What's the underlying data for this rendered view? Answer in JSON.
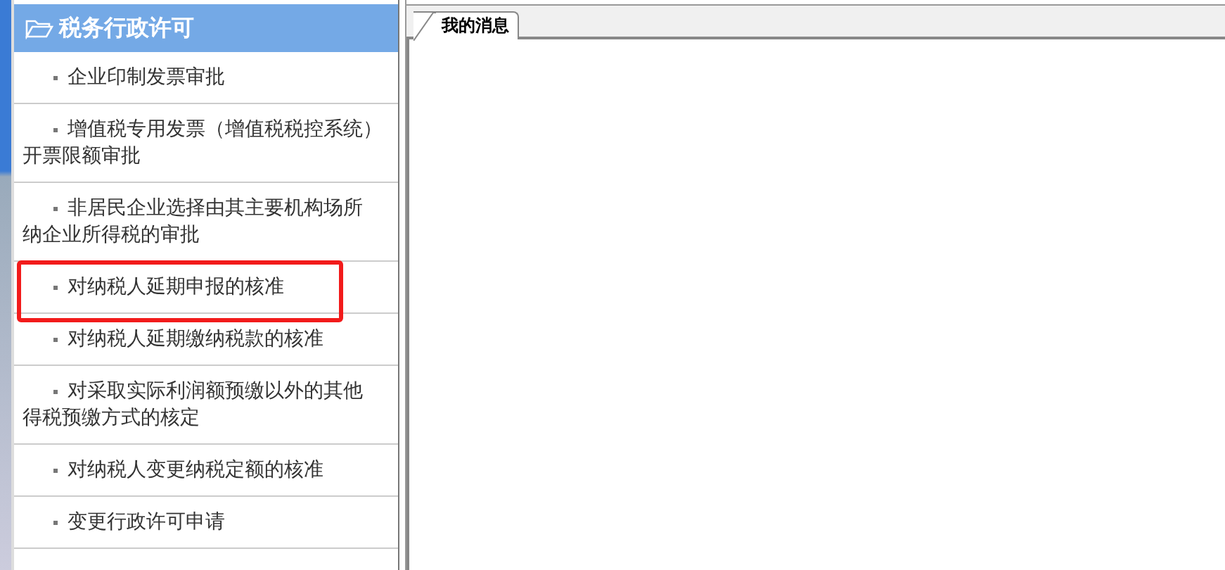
{
  "sidebar": {
    "title": "税务行政许可",
    "items": [
      {
        "lines": [
          "企业印制发票审批"
        ],
        "selected": false
      },
      {
        "lines": [
          "增值税专用发票（增值税税控系统）",
          "开票限额审批"
        ],
        "selected": false
      },
      {
        "lines": [
          "非居民企业选择由其主要机构场所",
          "纳企业所得税的审批"
        ],
        "selected": false
      },
      {
        "lines": [
          "对纳税人延期申报的核准"
        ],
        "selected": true
      },
      {
        "lines": [
          "对纳税人延期缴纳税款的核准"
        ],
        "selected": false
      },
      {
        "lines": [
          "对采取实际利润额预缴以外的其他",
          "得税预缴方式的核定"
        ],
        "selected": false
      },
      {
        "lines": [
          "对纳税人变更纳税定额的核准"
        ],
        "selected": false
      },
      {
        "lines": [
          "变更行政许可申请"
        ],
        "selected": false
      }
    ]
  },
  "tabs": [
    {
      "label": "我的消息",
      "selected": true
    }
  ]
}
